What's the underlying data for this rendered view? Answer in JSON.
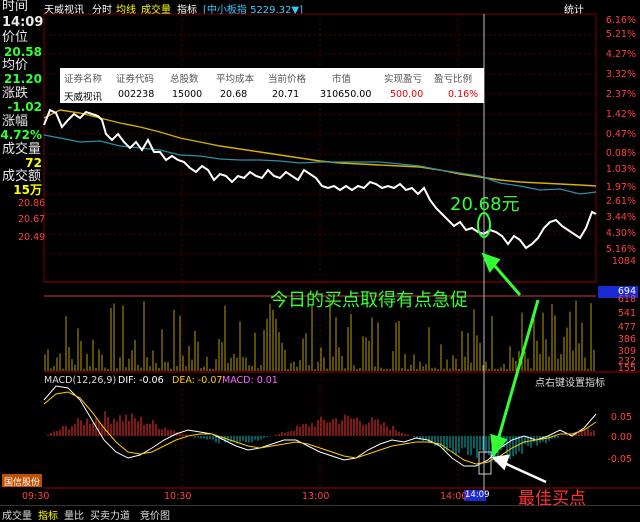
{
  "header": {
    "time_label": "时间",
    "stock_name": "天威视讯",
    "tabs": [
      "分时",
      "均线",
      "成交量",
      "指标"
    ],
    "index_label": "[中小板指 5229.32▼]",
    "stats_label": "统计"
  },
  "info_panel": {
    "time": "14:09",
    "price_label": "价位",
    "price": "20.58",
    "avg_label": "均价",
    "avg": "21.20",
    "change_label": "涨跌",
    "change": "-1.02",
    "pct_label": "涨幅",
    "pct": "-4.72%",
    "vol_label": "成交量",
    "vol": "72",
    "amount_label": "成交额",
    "amount": "15万"
  },
  "holdings": {
    "headers": [
      "证券名称",
      "证券代码",
      "总股数",
      "平均成本",
      "当前价格",
      "市值",
      "实现盈亏",
      "盈亏比例"
    ],
    "row": [
      "天威视讯",
      "002238",
      "15000",
      "20.68",
      "20.71",
      "310650.00",
      "500.00",
      "0.16%"
    ]
  },
  "right_axis": [
    "6.16%",
    "5.21%",
    "4.27%",
    "3.32%",
    "2.37%",
    "1.42%",
    "0.47%",
    "0.08%",
    "1.03%",
    "1.97%",
    "2.61%",
    "3.44%",
    "4.30%",
    "5.16%"
  ],
  "left_axis": [
    "20.86",
    "20.67",
    "20.49"
  ],
  "volume_axis": [
    "1084",
    "694",
    "618",
    "541",
    "477",
    "386",
    "309",
    "232",
    "155",
    "77"
  ],
  "volume_highlight": "694",
  "macd": {
    "label": "MACD(12,26,9)",
    "dif": "DIF: -0.06",
    "dea": "DEA: -0.07",
    "macd": "MACD: 0.01",
    "settings": "点右键设置指标",
    "axis": [
      "0.05",
      "0.00",
      "-0.05"
    ]
  },
  "annotations": {
    "price_note": "20.68元",
    "buy_note": "今日的买点取得有点急促",
    "best_buy": "最佳买点",
    "cursor_time": "14:09"
  },
  "time_axis": [
    "09:30",
    "10:30",
    "13:00",
    "14:00"
  ],
  "logo": "国信股份",
  "bottom_tabs": [
    "成交量",
    "指标",
    "量比",
    "买卖力道",
    "竞价图"
  ],
  "colors": {
    "down": "#ff4040",
    "annotation": "#33ff33",
    "price_line": "#ffffff",
    "avg_line": "#d4b000"
  }
}
